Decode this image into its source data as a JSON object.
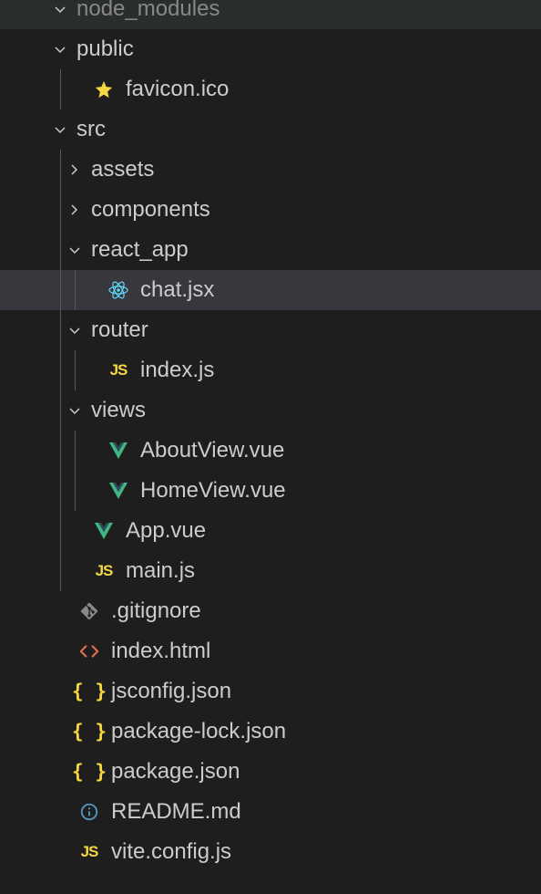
{
  "tree": {
    "items": [
      {
        "label": "node_modules",
        "type": "folder",
        "expanded": true,
        "depth": 0,
        "icon": "chevron-down",
        "dimmed": true,
        "partial": true
      },
      {
        "label": "public",
        "type": "folder",
        "expanded": true,
        "depth": 0,
        "icon": "chevron-down"
      },
      {
        "label": "favicon.ico",
        "type": "file",
        "depth": 1,
        "icon": "star",
        "guides": [
          true
        ]
      },
      {
        "label": "src",
        "type": "folder",
        "expanded": true,
        "depth": 0,
        "icon": "chevron-down"
      },
      {
        "label": "assets",
        "type": "folder",
        "expanded": false,
        "depth": 1,
        "icon": "chevron-right",
        "guides": [
          true
        ]
      },
      {
        "label": "components",
        "type": "folder",
        "expanded": false,
        "depth": 1,
        "icon": "chevron-right",
        "guides": [
          true
        ]
      },
      {
        "label": "react_app",
        "type": "folder",
        "expanded": true,
        "depth": 1,
        "icon": "chevron-down",
        "guides": [
          true
        ]
      },
      {
        "label": "chat.jsx",
        "type": "file",
        "depth": 2,
        "icon": "react",
        "selected": true,
        "guides": [
          true,
          true
        ]
      },
      {
        "label": "router",
        "type": "folder",
        "expanded": true,
        "depth": 1,
        "icon": "chevron-down",
        "guides": [
          true
        ]
      },
      {
        "label": "index.js",
        "type": "file",
        "depth": 2,
        "icon": "js",
        "guides": [
          true,
          true
        ]
      },
      {
        "label": "views",
        "type": "folder",
        "expanded": true,
        "depth": 1,
        "icon": "chevron-down",
        "guides": [
          true
        ]
      },
      {
        "label": "AboutView.vue",
        "type": "file",
        "depth": 2,
        "icon": "vue",
        "guides": [
          true,
          true
        ]
      },
      {
        "label": "HomeView.vue",
        "type": "file",
        "depth": 2,
        "icon": "vue",
        "guides": [
          true,
          true
        ]
      },
      {
        "label": "App.vue",
        "type": "file",
        "depth": 1,
        "icon": "vue",
        "guides": [
          true
        ]
      },
      {
        "label": "main.js",
        "type": "file",
        "depth": 1,
        "icon": "js",
        "guides": [
          true
        ]
      },
      {
        "label": ".gitignore",
        "type": "file",
        "depth": 0,
        "icon": "git"
      },
      {
        "label": "index.html",
        "type": "file",
        "depth": 0,
        "icon": "html"
      },
      {
        "label": "jsconfig.json",
        "type": "file",
        "depth": 0,
        "icon": "json"
      },
      {
        "label": "package-lock.json",
        "type": "file",
        "depth": 0,
        "icon": "json"
      },
      {
        "label": "package.json",
        "type": "file",
        "depth": 0,
        "icon": "json"
      },
      {
        "label": "README.md",
        "type": "file",
        "depth": 0,
        "icon": "info"
      },
      {
        "label": "vite.config.js",
        "type": "file",
        "depth": 0,
        "icon": "js"
      }
    ]
  },
  "icons": {
    "star_color": "#f5d742",
    "js_color": "#f5d742",
    "vue_color": "#41b883",
    "react_color": "#61dafb",
    "git_color": "#888888",
    "html_color": "#e06c4e",
    "json_color": "#f5d742",
    "info_color": "#519aba"
  }
}
